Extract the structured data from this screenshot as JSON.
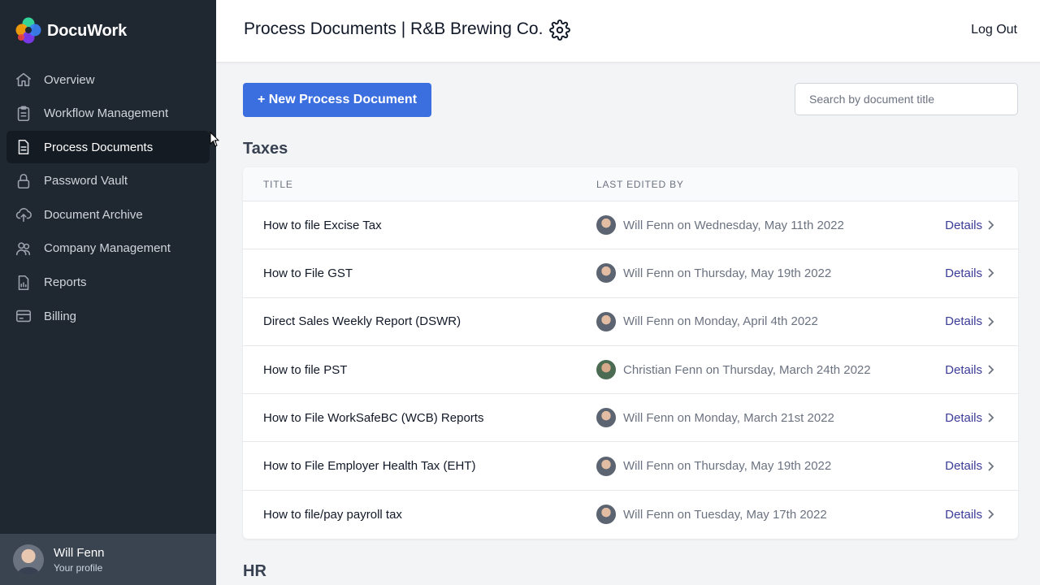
{
  "app": {
    "name": "DocuWork"
  },
  "sidebar": {
    "items": [
      {
        "label": "Overview",
        "icon": "home-icon"
      },
      {
        "label": "Workflow Management",
        "icon": "clipboard-icon"
      },
      {
        "label": "Process Documents",
        "icon": "document-icon",
        "active": true
      },
      {
        "label": "Password Vault",
        "icon": "lock-icon"
      },
      {
        "label": "Document Archive",
        "icon": "cloud-upload-icon"
      },
      {
        "label": "Company Management",
        "icon": "users-icon"
      },
      {
        "label": "Reports",
        "icon": "report-icon"
      },
      {
        "label": "Billing",
        "icon": "credit-card-icon"
      }
    ],
    "profile": {
      "name": "Will Fenn",
      "subtitle": "Your profile"
    }
  },
  "header": {
    "title": "Process Documents | R&B Brewing Co.",
    "logout_label": "Log Out"
  },
  "toolbar": {
    "new_label": "+ New Process Document",
    "search_placeholder": "Search by document title"
  },
  "sections": {
    "taxes": {
      "title": "Taxes",
      "columns": [
        "TITLE",
        "LAST EDITED BY"
      ],
      "details_label": "Details",
      "rows": [
        {
          "title": "How to file Excise Tax",
          "edited": "Will Fenn on Wednesday, May 11th 2022"
        },
        {
          "title": "How to File GST",
          "edited": "Will Fenn on Thursday, May 19th 2022"
        },
        {
          "title": "Direct Sales Weekly Report (DSWR)",
          "edited": "Will Fenn on Monday, April 4th 2022"
        },
        {
          "title": "How to file PST",
          "edited": "Christian Fenn on Thursday, March 24th 2022"
        },
        {
          "title": "How to File WorkSafeBC (WCB) Reports",
          "edited": "Will Fenn on Monday, March 21st 2022"
        },
        {
          "title": "How to File Employer Health Tax (EHT)",
          "edited": "Will Fenn on Thursday, May 19th 2022"
        },
        {
          "title": "How to file/pay payroll tax",
          "edited": "Will Fenn on Tuesday, May 17th 2022"
        }
      ]
    },
    "hr": {
      "title": "HR"
    }
  },
  "colors": {
    "sidebar_bg": "#1f2731",
    "primary_button": "#3b6fe0",
    "details_link": "#3b3b98"
  }
}
